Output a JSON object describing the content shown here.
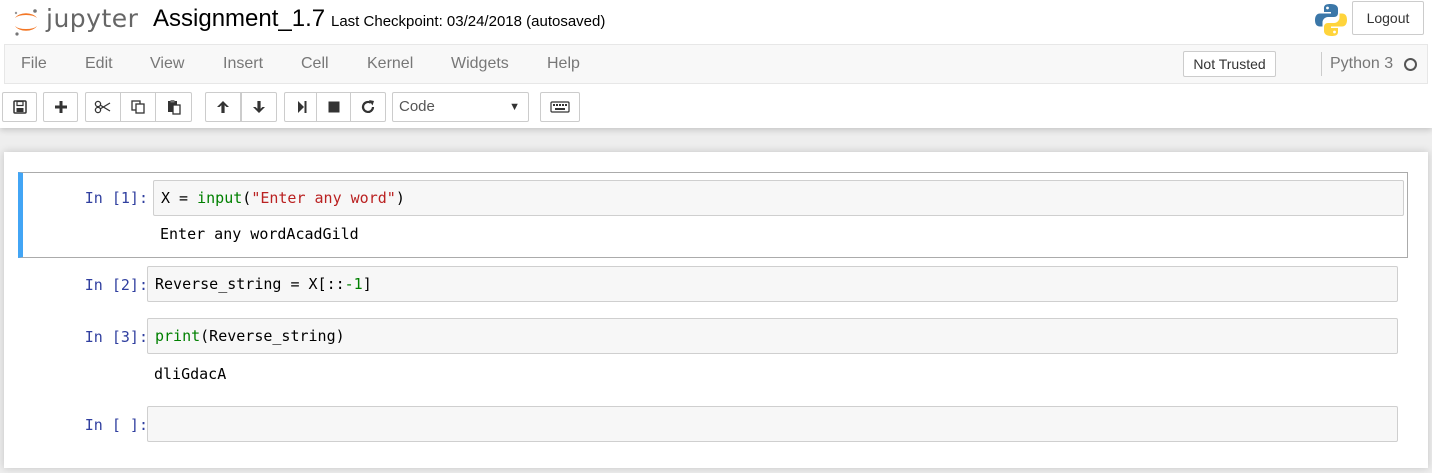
{
  "header": {
    "logo_text": "jupyter",
    "notebook_title": "Assignment_1.7",
    "checkpoint": "Last Checkpoint: 03/24/2018 (autosaved)",
    "logout_label": "Logout"
  },
  "menubar": {
    "items": [
      "File",
      "Edit",
      "View",
      "Insert",
      "Cell",
      "Kernel",
      "Widgets",
      "Help"
    ],
    "trust_label": "Not Trusted",
    "kernel_name": "Python 3"
  },
  "toolbar": {
    "buttons": [
      "save-icon",
      "plus-icon",
      "cut-icon",
      "copy-icon",
      "paste-icon",
      "arrow-up-icon",
      "arrow-down-icon",
      "run-icon",
      "stop-icon",
      "restart-icon",
      "keyboard-icon"
    ],
    "cell_type": "Code"
  },
  "cells": [
    {
      "prompt": "In [1]:",
      "code": {
        "p1": "X = ",
        "p2": "input",
        "p3": "(",
        "p4": "\"Enter any word\"",
        "p5": ")"
      },
      "output": "Enter any wordAcadGild"
    },
    {
      "prompt": "In [2]:",
      "code": {
        "p1": "Reverse_string = X[::",
        "p2": "-1",
        "p3": "]"
      }
    },
    {
      "prompt": "In [3]:",
      "code": {
        "p1": "print",
        "p2": "(Reverse_string)"
      },
      "output": "dliGdacA"
    },
    {
      "prompt": "In [ ]:",
      "code": {
        "p1": ""
      }
    }
  ],
  "colors": {
    "accent_selected": "#42a5f5",
    "prompt": "#303f9f",
    "builtin": "#008000",
    "string": "#ba2121",
    "logo_orange": "#f37726"
  }
}
